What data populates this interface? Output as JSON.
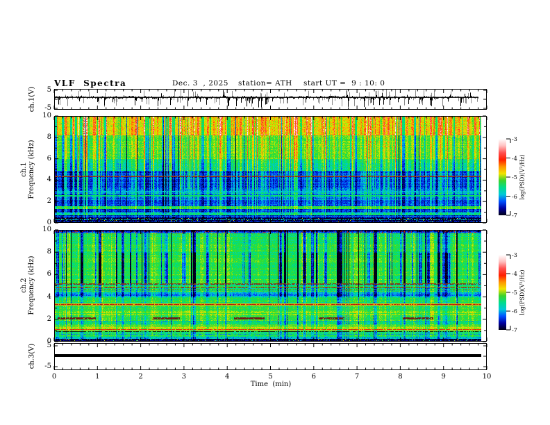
{
  "title": {
    "main": "VLF  Spectra",
    "date": "Dec. 3  , 2025",
    "station": "station= ATH",
    "start_ut": "start UT =  9 : 10: 0"
  },
  "axes": {
    "x": {
      "label": "Time  (min)",
      "min": 0,
      "max": 10,
      "major_ticks": [
        0,
        1,
        2,
        3,
        4,
        5,
        6,
        7,
        8,
        9,
        10
      ],
      "minor_step": 0.2
    },
    "freq": {
      "major_ticks": [
        10,
        8,
        6,
        4,
        2,
        0
      ],
      "minor_ticks": [
        9,
        7,
        5,
        3,
        1
      ],
      "unit": "kHz"
    },
    "volt": {
      "ticks": [
        5,
        0,
        -5
      ],
      "labeled": [
        5,
        -5
      ]
    }
  },
  "panels": {
    "ch1_wave": {
      "ylabel": "ch.1(V)",
      "ytick_top": "5",
      "ytick_bottom": "-5"
    },
    "spec1": {
      "ylabel_line1": "ch.1",
      "ylabel_line2": "Frequency  (kHz)"
    },
    "spec2": {
      "ylabel_line1": "ch.2",
      "ylabel_line2": "Frequency  (kHz)"
    },
    "ch3_wave": {
      "ylabel": "ch.3(V)",
      "ytick_top": "5",
      "ytick_bottom": "-5"
    }
  },
  "colorbar": {
    "label": "log(PSD)(V²/Hz)",
    "tick_labels": [
      "-3",
      "-4",
      "-5",
      "-6",
      "-7"
    ],
    "top_value": -3,
    "bottom_value": -7,
    "gradient": [
      "#ffffff",
      "#ffc0c0",
      "#ff5050",
      "#ff1e00",
      "#ff9400",
      "#f2e400",
      "#3cd22c",
      "#00dc8c",
      "#00c8d8",
      "#0050ff",
      "#0000a0",
      "#000014"
    ]
  },
  "colormap_stops": [
    [
      0.0,
      0,
      0,
      20
    ],
    [
      0.1,
      0,
      0,
      150
    ],
    [
      0.22,
      0,
      70,
      255
    ],
    [
      0.34,
      0,
      200,
      215
    ],
    [
      0.46,
      0,
      225,
      110
    ],
    [
      0.56,
      60,
      220,
      40
    ],
    [
      0.68,
      215,
      235,
      0
    ],
    [
      0.77,
      255,
      160,
      0
    ],
    [
      0.85,
      255,
      55,
      25
    ],
    [
      0.93,
      255,
      160,
      160
    ],
    [
      1.0,
      255,
      255,
      255
    ]
  ],
  "chart_data": [
    {
      "type": "line",
      "panel": "ch1_waveform",
      "ylabel": "ch.1(V)",
      "ylim": [
        -5,
        5
      ],
      "x_range_min": [
        0,
        10
      ],
      "data_end_min": 9.8,
      "baseline_v": 0.5,
      "noise_amp": 0.9,
      "spike_down_prob": 0.06,
      "spike_up_prob": 0.035,
      "gray_spike_prob": 0.2,
      "spike_max": 5.0,
      "description": "dense noisy voltage trace near +0.5 V with impulsive bipolar spikes reaching the ±5 V limits; gray secondary trace behind black"
    },
    {
      "type": "heatmap",
      "panel": "ch1_spectrogram",
      "ylabel": "ch.1 Frequency (kHz)",
      "ylim": [
        0,
        10
      ],
      "colorbar_range": [
        -7,
        -3
      ],
      "colorbar_label": "log(PSD)(V²/Hz)",
      "streaks": {
        "pBright": 0.3,
        "bMin": 0.25,
        "bRange": 1.05,
        "pDark": 0.11,
        "dMin": 0.6,
        "dRange": 1.0,
        "pBlack": 0.02
      },
      "bands": [
        {
          "f": [
            8.2,
            10.01
          ],
          "v": -4.35,
          "s": 0.9,
          "d": 0.8,
          "rn": 0.15
        },
        {
          "f": [
            6.0,
            8.2
          ],
          "v": -4.85,
          "s": 0.9,
          "d": 0.9,
          "rn": 0.15
        },
        {
          "f": [
            4.9,
            6.0
          ],
          "v": -5.5,
          "s": 1.1,
          "d": 0.7,
          "rn": 0.2
        },
        {
          "f": [
            3.15,
            4.9
          ],
          "v": -6.35,
          "s": 1.2,
          "d": 0.4,
          "rn": 0.2
        },
        {
          "f": [
            2.7,
            3.15
          ],
          "v": -5.9,
          "s": 0.8,
          "d": 0.5,
          "rn": 0.35
        },
        {
          "f": [
            2.15,
            2.7
          ],
          "v": -6.1,
          "s": 0.8,
          "d": 0.5,
          "rn": 0.35
        },
        {
          "f": [
            1.55,
            2.15
          ],
          "v": -6.35,
          "s": 0.7,
          "d": 0.4,
          "rn": 0.3
        },
        {
          "f": [
            1.3,
            1.55
          ],
          "v": -4.95,
          "s": 0.4,
          "d": 0.3,
          "rn": 0.1
        },
        {
          "f": [
            0.95,
            1.3
          ],
          "v": -6.2,
          "s": 0.6,
          "d": 0.4,
          "rn": 0.3
        },
        {
          "f": [
            0.68,
            0.95
          ],
          "v": -5.35,
          "s": 0.5,
          "d": 0.3,
          "rn": 0.15
        },
        {
          "f": [
            0.42,
            0.68
          ],
          "v": -6.5,
          "s": 0.5,
          "d": 0.3,
          "rn": 0.3
        },
        {
          "f": [
            0,
            0.42
          ],
          "v": -6.92,
          "s": 0.15,
          "d": 0.1,
          "rn": 0.1,
          "speckle": true
        }
      ],
      "lines": [
        {
          "f": 4.33,
          "hw": 0.07,
          "rgb": [
            150,
            60,
            30
          ],
          "prob": 0.85
        },
        {
          "f": 2.9,
          "hw": 0.05,
          "v": -5.6,
          "prob": 0.8
        },
        {
          "f": 2.52,
          "hw": 0.06,
          "v": -5.1,
          "prob": 0.9
        },
        {
          "f": 0.55,
          "hw": 0.04,
          "v": -6.0,
          "prob": 0.5
        },
        {
          "f": 0.27,
          "hw": 0.05,
          "v": -5.6,
          "prob": 0.7
        },
        {
          "f": 0.12,
          "hw": 0.04,
          "v": -6.1,
          "prob": 0.6
        }
      ]
    },
    {
      "type": "heatmap",
      "panel": "ch2_spectrogram",
      "ylabel": "ch.2 Frequency (kHz)",
      "ylim": [
        0,
        10
      ],
      "colorbar_range": [
        -7,
        -3
      ],
      "colorbar_label": "log(PSD)(V²/Hz)",
      "streaks": {
        "pBright": 0.24,
        "bMin": 0.2,
        "bRange": 0.8,
        "pDark": 0.13,
        "dMin": 0.6,
        "dRange": 1.0,
        "pBlack": 0.02
      },
      "bands": [
        {
          "f": [
            9.75,
            10.01
          ],
          "v": -6.2,
          "s": 0.3,
          "d": 0.5,
          "rn": 0.3,
          "redSpeckle": true
        },
        {
          "f": [
            8.0,
            9.75
          ],
          "v": -5.15,
          "s": 0.7,
          "d": 1.0,
          "rn": 0.2
        },
        {
          "f": [
            5.25,
            8.0
          ],
          "v": -5.05,
          "s": 0.6,
          "d": 1.6,
          "rn": 0.2
        },
        {
          "f": [
            4.5,
            5.25
          ],
          "v": -5.2,
          "s": 0.5,
          "d": 0.8,
          "rn": 0.3
        },
        {
          "f": [
            3.95,
            4.5
          ],
          "v": -5.85,
          "s": 0.6,
          "d": 0.6,
          "rn": 0.35
        },
        {
          "f": [
            3.42,
            3.95
          ],
          "v": -5.05,
          "s": 0.5,
          "d": 0.5,
          "rn": 0.2
        },
        {
          "f": [
            2.85,
            3.42
          ],
          "v": -4.95,
          "s": 0.4,
          "d": 0.4,
          "rn": 0.25
        },
        {
          "f": [
            2.35,
            2.85
          ],
          "v": -4.7,
          "s": 0.4,
          "d": 0.4,
          "rn": 0.25
        },
        {
          "f": [
            1.5,
            2.35
          ],
          "v": -5.05,
          "s": 0.5,
          "d": 0.6,
          "rn": 0.3
        },
        {
          "f": [
            1.28,
            1.5
          ],
          "v": -4.65,
          "s": 0.3,
          "d": 0.3,
          "rn": 0.2
        },
        {
          "f": [
            0.98,
            1.28
          ],
          "v": -4.35,
          "s": 0.3,
          "d": 0.3,
          "rn": 0.25
        },
        {
          "f": [
            0.42,
            0.98
          ],
          "v": -5.25,
          "s": 0.4,
          "d": 0.5,
          "rn": 0.4
        },
        {
          "f": [
            0.22,
            0.42
          ],
          "v": -5.75,
          "s": 0.3,
          "d": 0.4,
          "rn": 0.3
        },
        {
          "f": [
            0,
            0.22
          ],
          "v": -6.9,
          "s": 0.1,
          "d": 0.1,
          "rn": 0.1,
          "speckle": true
        }
      ],
      "lines": [
        {
          "f": 5.15,
          "hw": 0.06,
          "rgb": [
            140,
            60,
            25
          ],
          "prob": 0.7
        },
        {
          "f": 4.85,
          "hw": 0.06,
          "rgb": [
            150,
            70,
            30
          ],
          "prob": 0.6
        },
        {
          "f": 4.62,
          "hw": 0.05,
          "rgb": [
            120,
            80,
            40
          ],
          "prob": 0.5
        },
        {
          "f": 3.3,
          "hw": 0.08,
          "v": -3.95,
          "prob": 1.0
        },
        {
          "f": 3.3,
          "hw": 0.03,
          "rgb": [
            200,
            40,
            10
          ],
          "prob": 0.8
        },
        {
          "f": 2.08,
          "hw": 0.09,
          "rgb": [
            120,
            30,
            20
          ],
          "segments": [
            [
              0.08,
              0.95
            ],
            [
              2.25,
              2.9
            ],
            [
              4.15,
              4.85
            ],
            [
              6.1,
              6.7
            ],
            [
              8.05,
              8.75
            ]
          ]
        },
        {
          "f": 1.75,
          "hw": 0.035,
          "v": -5.9,
          "prob": 0.5
        },
        {
          "f": 1.05,
          "hw": 0.05,
          "rgb": [
            230,
            60,
            10
          ],
          "prob": 0.85
        },
        {
          "f": 0.88,
          "hw": 0.04,
          "rgb": [
            20,
            40,
            10
          ],
          "prob": 0.7
        },
        {
          "f": 0.6,
          "hw": 0.035,
          "v": -5.9,
          "prob": 0.5
        },
        {
          "f": 0.35,
          "hw": 0.03,
          "v": -5.4,
          "prob": 0.6
        }
      ]
    },
    {
      "type": "line",
      "panel": "ch3_waveform",
      "ylabel": "ch.3(V)",
      "ylim": [
        -5,
        5
      ],
      "x_range_min": [
        0,
        10
      ],
      "data_end_min": 9.8,
      "constant_value": 0,
      "description": "flat thick black line at ~0 V across the full record (dead/flat channel)"
    }
  ]
}
